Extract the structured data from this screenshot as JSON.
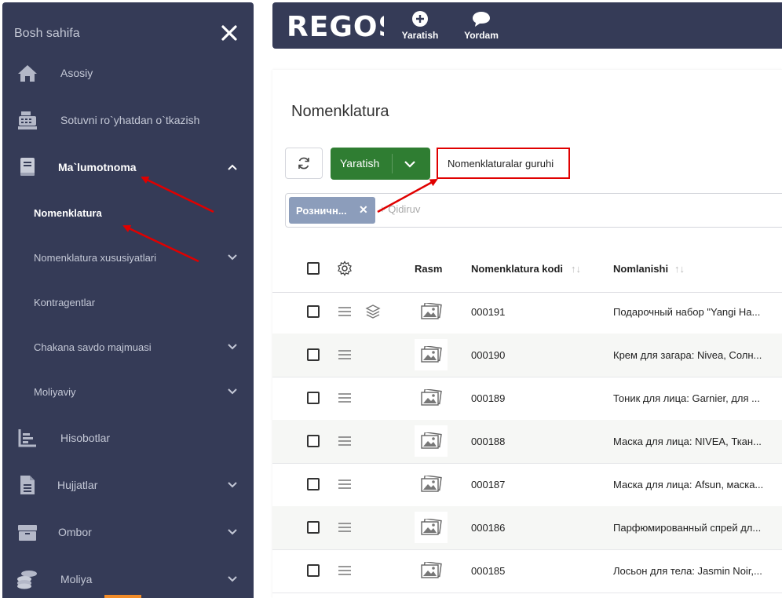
{
  "sidebar": {
    "header": "Bosh sahifa",
    "items": [
      {
        "label": "Asosiy",
        "icon": "home-icon"
      },
      {
        "label": "Sotuvni ro`yhatdan o`tkazish",
        "icon": "cash-register-icon"
      },
      {
        "label": "Ma`lumotnoma",
        "icon": "book-icon"
      },
      {
        "label": "Nomenklatura"
      },
      {
        "label": "Nomenklatura xususiyatlari"
      },
      {
        "label": "Kontragentlar"
      },
      {
        "label": "Chakana savdo majmuasi"
      },
      {
        "label": "Moliyaviy"
      },
      {
        "label": "Hisobotlar",
        "icon": "chart-icon"
      },
      {
        "label": "Hujjatlar",
        "icon": "document-icon"
      },
      {
        "label": "Ombor",
        "icon": "box-icon"
      },
      {
        "label": "Moliya",
        "icon": "coins-icon"
      }
    ]
  },
  "topbar": {
    "logo": "REGOS",
    "create_label": "Yaratish",
    "help_label": "Yordam"
  },
  "page": {
    "title": "Nomenklatura",
    "create_button": "Yaratish",
    "group_button": "Nomenklaturalar guruhi",
    "filter_chip": "Розничн...",
    "search_placeholder": "+ Qidiruv"
  },
  "table": {
    "headers": {
      "image": "Rasm",
      "code": "Nomenklatura kodi",
      "name": "Nomlanishi"
    },
    "rows": [
      {
        "code": "000191",
        "name": "Подарочный набор \"Yangi На..."
      },
      {
        "code": "000190",
        "name": "Крем для загара: Nivea, Солн..."
      },
      {
        "code": "000189",
        "name": "Тоник для лица: Garnier, для ..."
      },
      {
        "code": "000188",
        "name": "Маска для лица: NIVEA, Ткан..."
      },
      {
        "code": "000187",
        "name": "Маска для лица: Afsun, маска..."
      },
      {
        "code": "000186",
        "name": "Парфюмированный спрей дл..."
      },
      {
        "code": "000185",
        "name": "Лосьон для тела: Jasmin Noir,..."
      }
    ]
  },
  "colors": {
    "sidebar_bg": "#353b57",
    "primary_green": "#2f7d32",
    "chip_bg": "#8c9dbb",
    "annotation_red": "#e00000"
  }
}
